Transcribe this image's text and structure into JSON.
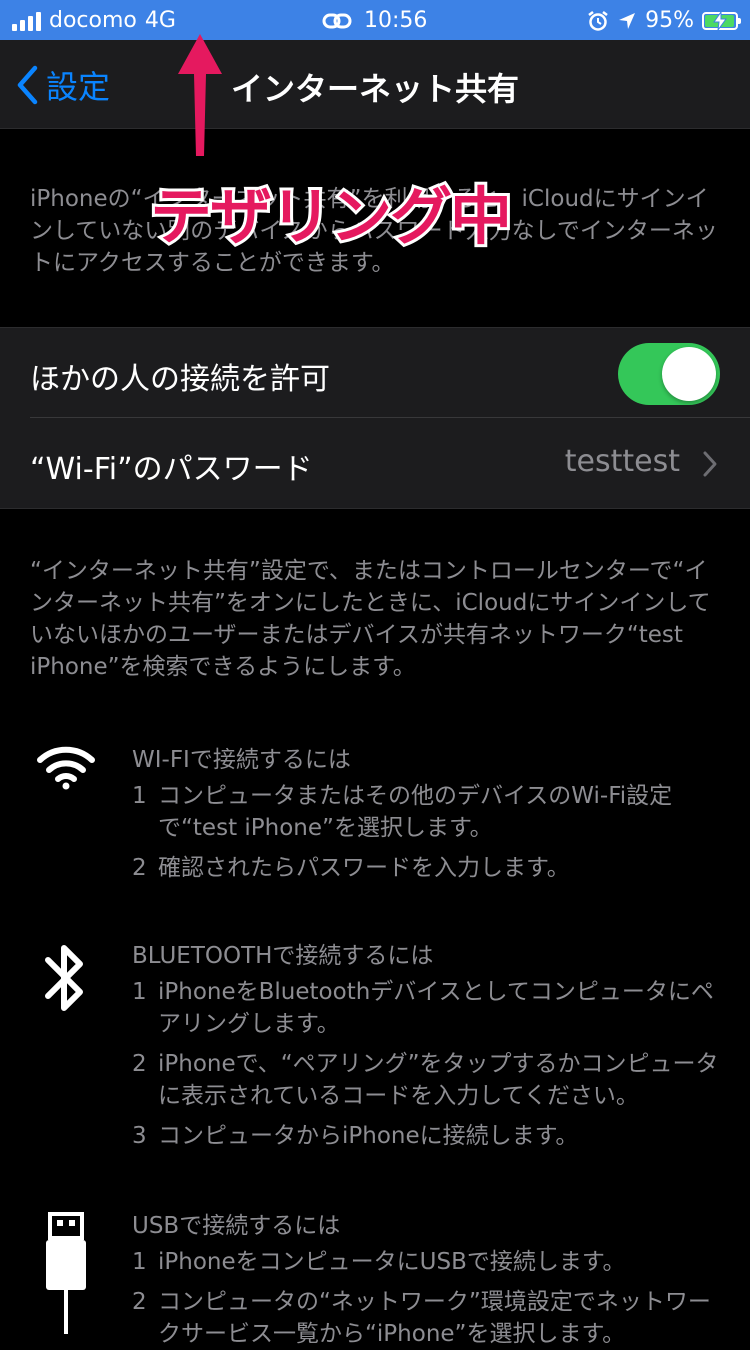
{
  "status_bar": {
    "carrier": "docomo",
    "network": "4G",
    "time": "10:56",
    "battery_percent": "95%",
    "battery_level": 0.95,
    "background_color": "#3d82e6",
    "icons": [
      "signal-icon",
      "hotspot-link-icon",
      "alarm-icon",
      "location-arrow-icon",
      "battery-icon"
    ]
  },
  "nav": {
    "back_label": "設定",
    "title": "インターネット共有"
  },
  "intro_text": "iPhoneの“インターネット共有”を利用すると、iCloudにサインインしていない別のデバイスからパスワード入力なしでインターネットにアクセスすることができます。",
  "settings": {
    "allow_others_label": "ほかの人の接続を許可",
    "allow_others_enabled": true,
    "wifi_password_label": "“Wi-Fi”のパスワード",
    "wifi_password_value": "testtest"
  },
  "footer_text": "“インターネット共有”設定で、またはコントロールセンターで“インターネット共有”をオンにしたときに、iCloudにサインインしていないほかのユーザーまたはデバイスが共有ネットワーク“test iPhone”を検索できるようにします。",
  "instructions": {
    "wifi": {
      "icon": "wifi-icon",
      "title": "WI-FIで接続するには",
      "steps": [
        {
          "num": "1",
          "text": "コンピュータまたはその他のデバイスのWi-Fi設定で“test iPhone”を選択します。"
        },
        {
          "num": "2",
          "text": "確認されたらパスワードを入力します。"
        }
      ]
    },
    "bluetooth": {
      "icon": "bluetooth-icon",
      "title": "BLUETOOTHで接続するには",
      "steps": [
        {
          "num": "1",
          "text": "iPhoneをBluetoothデバイスとしてコンピュータにペアリングします。"
        },
        {
          "num": "2",
          "text": "iPhoneで、“ペアリング”をタップするかコンピュータに表示されているコードを入力してください。"
        },
        {
          "num": "3",
          "text": "コンピュータからiPhoneに接続します。"
        }
      ]
    },
    "usb": {
      "icon": "usb-cable-icon",
      "title": "USBで接続するには",
      "steps": [
        {
          "num": "1",
          "text": "iPhoneをコンピュータにUSBで接続します。"
        },
        {
          "num": "2",
          "text": "コンピュータの“ネットワーク”環境設定でネットワークサービス一覧から“iPhone”を選択します。"
        }
      ]
    }
  },
  "annotation": {
    "label": "テザリング中",
    "color": "#e5195f"
  },
  "colors": {
    "accent": "#0a84ff",
    "toggle_on": "#34c759",
    "secondary_text": "#8d8d92",
    "group_background": "#1c1c1e"
  }
}
